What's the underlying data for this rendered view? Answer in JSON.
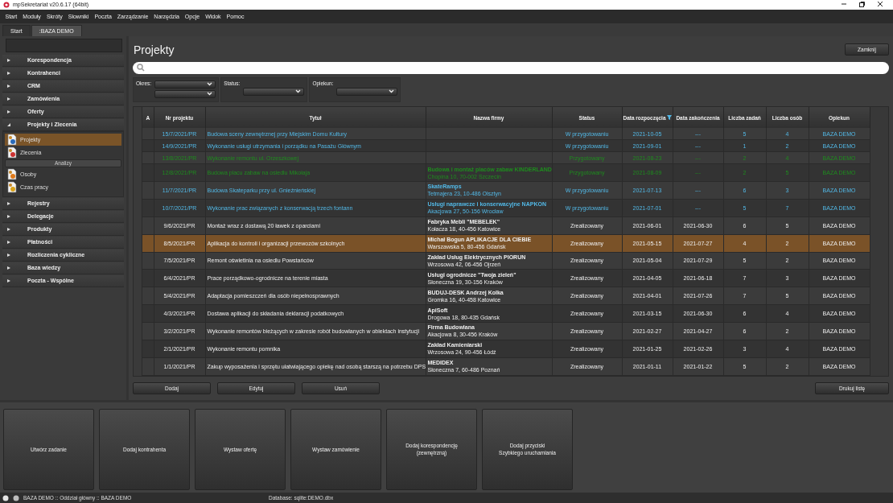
{
  "window": {
    "title": "mpSekretariat v20.6.17 (64bit)"
  },
  "menu": [
    "Start",
    "Moduły",
    "Skróty",
    "Słowniki",
    "Poczta",
    "Zarządzanie",
    "Narzędzia",
    "Opcje",
    "Widok",
    "Pomoc"
  ],
  "tabs": [
    {
      "label": "Start",
      "selected": false
    },
    {
      "label": ":BAZA DEMO",
      "selected": true
    }
  ],
  "sidebar": {
    "groups": [
      {
        "label": "Korespondencja",
        "expanded": false
      },
      {
        "label": "Kontrahenci",
        "expanded": false
      },
      {
        "label": "CRM",
        "expanded": false
      },
      {
        "label": "Zamówienia",
        "expanded": false
      },
      {
        "label": "Oferty",
        "expanded": false
      },
      {
        "label": "Projekty i Zlecenia",
        "expanded": true,
        "children": [
          {
            "kind": "item",
            "label": "Projekty",
            "selected": true
          },
          {
            "kind": "item",
            "label": "Zlecenia",
            "selected": false
          },
          {
            "kind": "header",
            "label": "Analizy"
          },
          {
            "kind": "item",
            "label": "Osoby",
            "selected": false
          },
          {
            "kind": "item",
            "label": "Czas pracy",
            "selected": false
          }
        ]
      },
      {
        "label": "Rejestry",
        "expanded": false
      },
      {
        "label": "Delegacje",
        "expanded": false
      },
      {
        "label": "Produkty",
        "expanded": false
      },
      {
        "label": "Płatności",
        "expanded": false
      },
      {
        "label": "Rozliczenia cykliczne",
        "expanded": false
      },
      {
        "label": "Baza wiedzy",
        "expanded": false
      },
      {
        "label": "Poczta - Wspólne",
        "expanded": false
      }
    ]
  },
  "page": {
    "title": "Projekty",
    "close_button": "Zamknij"
  },
  "filters": [
    {
      "label": "Okres:",
      "kind": "range"
    },
    {
      "label": "Status:",
      "kind": "single"
    },
    {
      "label": "Opiekun:",
      "kind": "single"
    }
  ],
  "table": {
    "columns": [
      "A",
      "Nr projektu",
      "Tytuł",
      "Nazwa firmy",
      "Status",
      "Data rozpoczęcia",
      "Data zakończenia",
      "Liczba zadań",
      "Liczba osób",
      "Opiekun"
    ],
    "rows": [
      {
        "nr": "15/7/2021/PR",
        "title": "Budowa sceny zewnętrznej przy Miejskim Domu Kultury",
        "status": "W przygotowaniu",
        "start": "2021-10-05",
        "end": "---",
        "tasks": "5",
        "people": "4",
        "owner": "BAZA DEMO",
        "kind": "in_preparation",
        "selected": false
      },
      {
        "nr": "14/9/2021/PR",
        "title": "Wykonanie usługi utrzymania i porządku na Pasażu Głównym",
        "status": "W przygotowaniu",
        "start": "2021-09-01",
        "end": "---",
        "tasks": "1",
        "people": "2",
        "owner": "BAZA DEMO",
        "kind": "in_preparation",
        "selected": false
      },
      {
        "nr": "13/8/2021/PR",
        "title": "Wykonanie remontu ul. Orzeszkowej",
        "status": "Przygotowany",
        "start": "2021-08-23",
        "end": "---",
        "tasks": "2",
        "people": "4",
        "owner": "BAZA DEMO",
        "kind": "prepared",
        "selected": false
      },
      {
        "nr": "12/8/2021/PR",
        "title": "Budowa placu zabaw na osiedlu Mikołaja",
        "company": "Budowa i montaż placów zabaw KINDERLAND",
        "address": "Chopina 10, 70-002 Szczecin",
        "status": "Przygotowany",
        "start": "2021-08-09",
        "end": "---",
        "tasks": "2",
        "people": "5",
        "owner": "BAZA DEMO",
        "kind": "prepared",
        "selected": false
      },
      {
        "nr": "11/7/2021/PR",
        "title": "Budowa Skateparku przy ul. Gnieźnieńskiej",
        "company": "SkateRamps",
        "address": "Tetmajera 23, 10-486 Olsztyn",
        "status": "W przygotowaniu",
        "start": "2021-07-13",
        "end": "---",
        "tasks": "6",
        "people": "3",
        "owner": "BAZA DEMO",
        "kind": "in_preparation",
        "selected": false
      },
      {
        "nr": "10/7/2021/PR",
        "title": "Wykonanie prac związanych z konserwacją trzech fontann",
        "company": "Usługi naprawcze i konserwacyjne NAPKON",
        "address": "Akacjowa 27, 50-156 Wrocław",
        "status": "W przygotowaniu",
        "start": "2021-07-01",
        "end": "---",
        "tasks": "5",
        "people": "7",
        "owner": "BAZA DEMO",
        "kind": "in_preparation",
        "selected": false
      },
      {
        "nr": "9/6/2021/PR",
        "title": "Montaż wraz z dostawą 20 ławek z oparciami",
        "company": "Fabryka Mebli \"MEBELEK\"",
        "address": "Kołacza 18, 40-456 Katowice",
        "status": "Zrealizowany",
        "start": "2021-06-01",
        "end": "2021-06-30",
        "tasks": "6",
        "people": "5",
        "owner": "BAZA DEMO",
        "kind": "completed",
        "selected": false
      },
      {
        "nr": "8/5/2021/PR",
        "title": "Aplikacja do kontroli i organizacji przewozów szkolnych",
        "company": "Michał Bogun APLIKACJE DLA CIEBIE",
        "address": "Warszawska 5, 80-456 Gdańsk",
        "status": "Zrealizowany",
        "start": "2021-05-15",
        "end": "2021-07-27",
        "tasks": "4",
        "people": "2",
        "owner": "BAZA DEMO",
        "kind": "completed",
        "selected": true
      },
      {
        "nr": "7/5/2021/PR",
        "title": "Remont oświetlnia na osiedlu Powstańców",
        "company": "Zakład Usług Elektrycznych PIORUN",
        "address": "Wrzosowa 42, 06-456 Ojrzeń",
        "status": "Zrealizowany",
        "start": "2021-05-04",
        "end": "2021-07-29",
        "tasks": "5",
        "people": "2",
        "owner": "BAZA DEMO",
        "kind": "completed",
        "selected": false
      },
      {
        "nr": "6/4/2021/PR",
        "title": "Prace porządkowo-ogrodnicze na terenie miasta",
        "company": "Usługi ogrodnicze \"Twoja zieleń\"",
        "address": "Słoneczna 19, 30-156 Kraków",
        "status": "Zrealizowany",
        "start": "2021-04-05",
        "end": "2021-06-18",
        "tasks": "7",
        "people": "3",
        "owner": "BAZA DEMO",
        "kind": "completed",
        "selected": false
      },
      {
        "nr": "5/4/2021/PR",
        "title": "Adaptacja pomieszczeń dla osób niepełnosprawnych",
        "company": "BUDUJ-DESK Andrzej Kolka",
        "address": "Gromka 16, 40-458 Katowice",
        "status": "Zrealizowany",
        "start": "2021-04-01",
        "end": "2021-07-26",
        "tasks": "7",
        "people": "5",
        "owner": "BAZA DEMO",
        "kind": "completed",
        "selected": false
      },
      {
        "nr": "4/3/2021/PR",
        "title": "Dostawa aplikacji do składania deklaracji podatkowych",
        "company": "ApiSoft",
        "address": "Drogowa 18, 80-435 Gdańsk",
        "status": "Zrealizowany",
        "start": "2021-03-15",
        "end": "2021-06-30",
        "tasks": "6",
        "people": "4",
        "owner": "BAZA DEMO",
        "kind": "completed",
        "selected": false
      },
      {
        "nr": "3/2/2021/PR",
        "title": "Wykonanie remontów bieżących w zakresie robót budowlanych w obiektach instytucji",
        "company": "Firma Budowlana",
        "address": "Akacjowa 8, 30-456 Kraków",
        "status": "Zrealizowany",
        "start": "2021-02-27",
        "end": "2021-04-27",
        "tasks": "6",
        "people": "2",
        "owner": "BAZA DEMO",
        "kind": "completed",
        "selected": false
      },
      {
        "nr": "2/1/2021/PR",
        "title": "Wykonanie remontu pomnika",
        "company": "Zakład Kamieniarski",
        "address": "Wrzosowa 24, 90-456 Łódź",
        "status": "Zrealizowany",
        "start": "2021-01-25",
        "end": "2021-02-26",
        "tasks": "3",
        "people": "4",
        "owner": "BAZA DEMO",
        "kind": "completed",
        "selected": false
      },
      {
        "nr": "1/1/2021/PR",
        "title": "Zakup wyposażenia i sprzętu ułatwiającego opiekę nad osobą starszą na potrzebu DPS",
        "company": "MEDIDEX",
        "address": "Słoneczna 7, 60-486 Poznań",
        "status": "Zrealizowany",
        "start": "2021-01-11",
        "end": "2021-01-22",
        "tasks": "5",
        "people": "2",
        "owner": "BAZA DEMO",
        "kind": "completed",
        "selected": false
      }
    ]
  },
  "actions": [
    "Dodaj",
    "Edytuj",
    "Usuń"
  ],
  "print_button": "Drukuj listę",
  "quick_buttons": [
    "Utwórz zadanie",
    "Dodaj kontrahenta",
    "Wystaw ofertę",
    "Wystaw zamówienie",
    "Dodaj korespondencję\n(zewnętrzną)",
    "Dodaj przyciski\nSzybkiego uruchamiania"
  ],
  "status_bar": {
    "context": "BAZA DEMO :: Oddział główny :: BAZA DEMO",
    "database": "Database: sqlite:DEMO.dbx"
  }
}
